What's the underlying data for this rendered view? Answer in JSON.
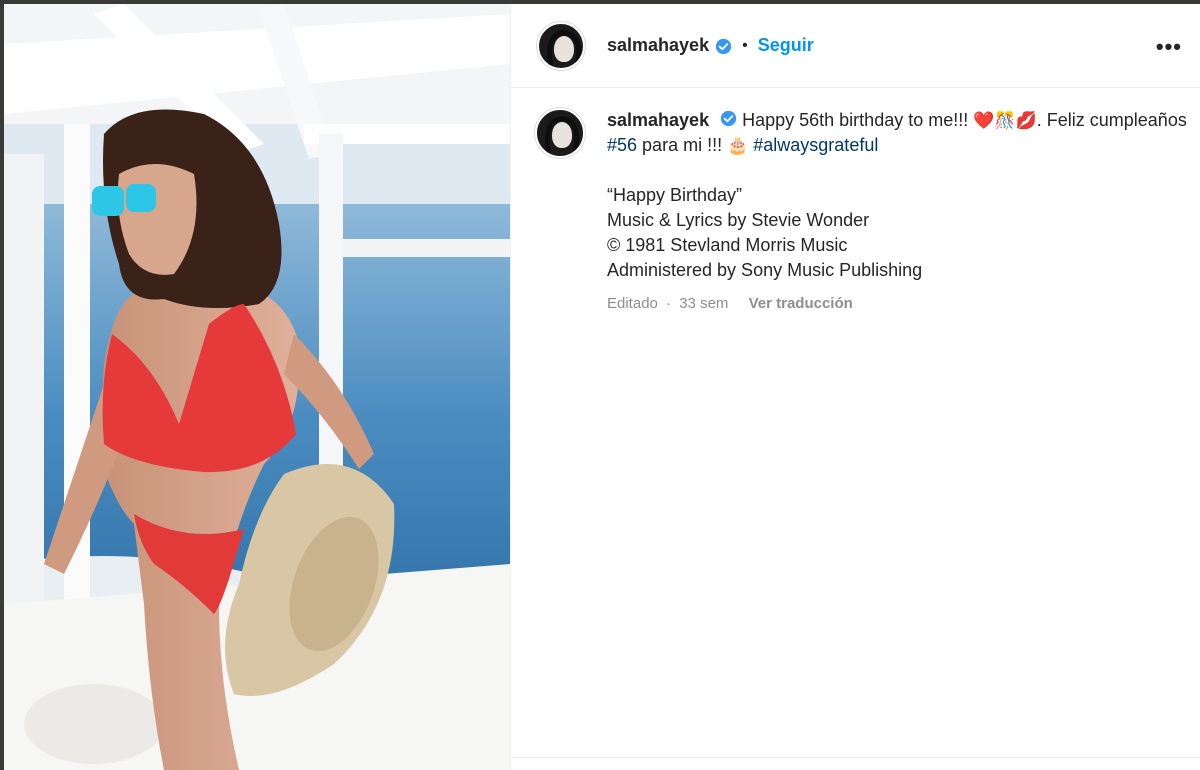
{
  "header": {
    "username": "salmahayek",
    "separator": "•",
    "follow_label": "Seguir",
    "more_label": "•••"
  },
  "caption": {
    "username": "salmahayek",
    "text_1": "Happy 56th birthday to me!!! ",
    "emojis_1": "❤️🎊💋",
    "text_2": ". Feliz cumpleaños ",
    "hashtag_1": "#56",
    "text_3": " para mi !!! ",
    "emoji_cake": "🎂",
    "hashtag_2": "#alwaysgrateful",
    "line_song": "“Happy Birthday”",
    "line_credit": "Music & Lyrics by Stevie Wonder",
    "line_copyright": "© 1981 Stevland Morris Music",
    "line_admin": "Administered by Sony Music Publishing"
  },
  "meta": {
    "edited": "Editado",
    "dot": "·",
    "age": "33 sem",
    "translate": "Ver traducción"
  },
  "colors": {
    "link": "#0095f6",
    "hashtag": "#00376b",
    "verified": "#3897f0",
    "muted": "#8e8e8e"
  }
}
